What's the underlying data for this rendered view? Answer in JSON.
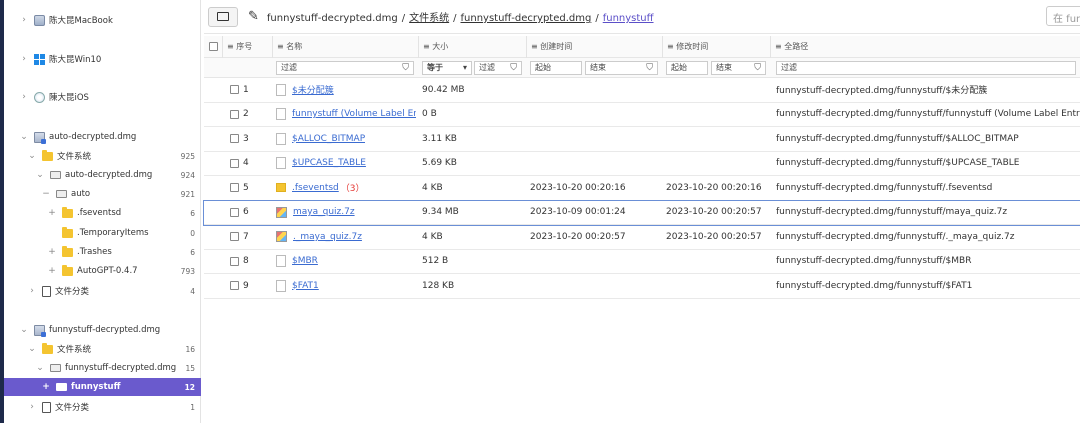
{
  "sidebar": {
    "devices": [
      {
        "label": "陈大昆MacBook",
        "icon": "macbook-icon"
      },
      {
        "label": "陈大昆Win10",
        "icon": "windows-icon"
      },
      {
        "label": "陳大昆iOS",
        "icon": "ios-icon"
      }
    ],
    "tree": [
      {
        "label": "auto-decrypted.dmg",
        "count": ""
      },
      {
        "label": "文件系统",
        "count": "925"
      },
      {
        "label": "auto-decrypted.dmg",
        "count": "924"
      },
      {
        "label": "auto",
        "count": "921"
      },
      {
        "label": ".fseventsd",
        "count": "6"
      },
      {
        "label": ".TemporaryItems",
        "count": "0"
      },
      {
        "label": ".Trashes",
        "count": "6"
      },
      {
        "label": "AutoGPT-0.4.7",
        "count": "793"
      },
      {
        "label": "文件分类",
        "count": "4"
      },
      {
        "label": "funnystuff-decrypted.dmg",
        "count": ""
      },
      {
        "label": "文件系统",
        "count": "16"
      },
      {
        "label": "funnystuff-decrypted.dmg",
        "count": "15"
      },
      {
        "label": "funnystuff",
        "count": "12"
      },
      {
        "label": "文件分类",
        "count": "1"
      }
    ]
  },
  "toolbar": {
    "crumbs": [
      "funnystuff-decrypted.dmg",
      "文件系统",
      "funnystuff-decrypted.dmg",
      "funnystuff"
    ],
    "search_placeholder": "在 funny"
  },
  "table": {
    "headers": {
      "index": "≡ 序号",
      "name": "≡ 名称",
      "size": "≡ 大小",
      "ctime": "≡ 创建时间",
      "mtime": "≡ 修改时间",
      "path": "≡ 全路径"
    },
    "filters": {
      "name": "过滤",
      "size_op": "等于",
      "size": "过滤",
      "ctime_start": "起始",
      "ctime_end": "结束",
      "mtime_start": "起始",
      "mtime_end": "结束",
      "path": "过滤"
    },
    "rows": [
      {
        "idx": "1",
        "name": "$未分配簇",
        "badge": "",
        "size": "90.42 MB",
        "ctime": "",
        "mtime": "",
        "path": "funnystuff-decrypted.dmg/funnystuff/$未分配簇"
      },
      {
        "idx": "2",
        "name": "funnystuff (Volume Label Er",
        "badge": "",
        "size": "0 B",
        "ctime": "",
        "mtime": "",
        "path": "funnystuff-decrypted.dmg/funnystuff/funnystuff (Volume Label Entry)"
      },
      {
        "idx": "3",
        "name": "$ALLOC_BITMAP",
        "badge": "",
        "size": "3.11 KB",
        "ctime": "",
        "mtime": "",
        "path": "funnystuff-decrypted.dmg/funnystuff/$ALLOC_BITMAP"
      },
      {
        "idx": "4",
        "name": "$UPCASE_TABLE",
        "badge": "",
        "size": "5.69 KB",
        "ctime": "",
        "mtime": "",
        "path": "funnystuff-decrypted.dmg/funnystuff/$UPCASE_TABLE"
      },
      {
        "idx": "5",
        "name": ".fseventsd",
        "badge": "（3）",
        "size": "4 KB",
        "ctime": "2023-10-20 00:20:16",
        "mtime": "2023-10-20 00:20:16",
        "path": "funnystuff-decrypted.dmg/funnystuff/.fseventsd"
      },
      {
        "idx": "6",
        "name": "maya_quiz.7z",
        "badge": "",
        "size": "9.34 MB",
        "ctime": "2023-10-09 00:01:24",
        "mtime": "2023-10-20 00:20:57",
        "path": "funnystuff-decrypted.dmg/funnystuff/maya_quiz.7z"
      },
      {
        "idx": "7",
        "name": "._maya_quiz.7z",
        "badge": "",
        "size": "4 KB",
        "ctime": "2023-10-20 00:20:57",
        "mtime": "2023-10-20 00:20:57",
        "path": "funnystuff-decrypted.dmg/funnystuff/._maya_quiz.7z"
      },
      {
        "idx": "8",
        "name": "$MBR",
        "badge": "",
        "size": "512 B",
        "ctime": "",
        "mtime": "",
        "path": "funnystuff-decrypted.dmg/funnystuff/$MBR"
      },
      {
        "idx": "9",
        "name": "$FAT1",
        "badge": "",
        "size": "128 KB",
        "ctime": "",
        "mtime": "",
        "path": "funnystuff-decrypted.dmg/funnystuff/$FAT1"
      }
    ]
  }
}
